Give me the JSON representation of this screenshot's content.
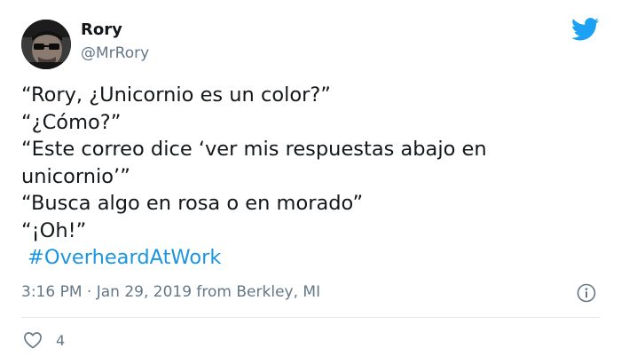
{
  "user": {
    "display_name": "Rory",
    "handle": "@MrRory",
    "avatar_icon": "person-with-sunglasses-avatar"
  },
  "brand": {
    "logo_icon": "twitter-bird-icon",
    "color": "#1da1f2"
  },
  "tweet": {
    "lines": [
      "“Rory, ¿Unicornio es un color?”",
      "“¿Cómo?”",
      "“Este correo dice ‘ver mis respuestas abajo en",
      "unicornio’”",
      "“Busca algo en rosa o en morado”",
      "“¡Oh!”"
    ],
    "hashtag": "#OverheardAtWork",
    "hashtag_color": "#1b95e0"
  },
  "meta": {
    "timestamp": "3:16 PM · Jan 29, 2019 from Berkley, MI",
    "info_icon": "info-icon"
  },
  "actions": {
    "like_icon": "heart-icon",
    "like_count": "4"
  }
}
